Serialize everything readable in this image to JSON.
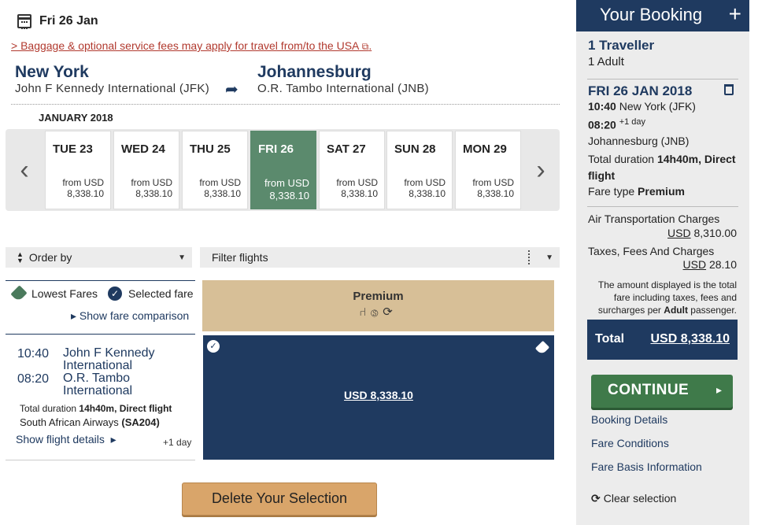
{
  "header": {
    "date": "Fri 26 Jan",
    "baggage_link": "> Baggage & optional service fees may apply for travel from/to the USA"
  },
  "route": {
    "origin_city": "New York",
    "origin_airport": "John F Kennedy International (JFK)",
    "dest_city": "Johannesburg",
    "dest_airport": "O.R. Tambo International (JNB)"
  },
  "calendar": {
    "month": "JANUARY 2018",
    "days": [
      {
        "label": "TUE 23",
        "from": "from USD",
        "price": "8,338.10"
      },
      {
        "label": "WED 24",
        "from": "from USD",
        "price": "8,338.10"
      },
      {
        "label": "THU 25",
        "from": "from USD",
        "price": "8,338.10"
      },
      {
        "label": "FRI 26",
        "from": "from USD",
        "price": "8,338.10"
      },
      {
        "label": "SAT 27",
        "from": "from USD",
        "price": "8,338.10"
      },
      {
        "label": "SUN 28",
        "from": "from USD",
        "price": "8,338.10"
      },
      {
        "label": "MON 29",
        "from": "from USD",
        "price": "8,338.10"
      }
    ]
  },
  "controls": {
    "order_by": "Order by",
    "filter": "Filter flights"
  },
  "legend": {
    "lowest": "Lowest Fares",
    "selected": "Selected fare",
    "compare": "Show fare comparison"
  },
  "cabin": {
    "name": "Premium"
  },
  "flight": {
    "dep_time": "10:40",
    "dep_airport": "John F Kennedy International",
    "arr_time": "08:20",
    "arr_airport": "O.R. Tambo International",
    "duration_label": "Total duration",
    "duration_value": "14h40m, Direct flight",
    "airline": "South African Airways",
    "flight_no": "(SA204)",
    "details": "Show flight details",
    "plus_day": "+1 day",
    "fare_price": "USD 8,338.10"
  },
  "delete_button": "Delete Your Selection",
  "booking": {
    "title": "Your Booking",
    "travellers": "1 Traveller",
    "adults": "1 Adult",
    "date": "FRI 26 JAN 2018",
    "dep_time": "10:40",
    "dep_city": "New York (JFK)",
    "arr_time": "08:20",
    "arr_plus": "+1 day",
    "arr_city": "Johannesburg (JNB)",
    "duration_label": "Total duration",
    "duration_value": "14h40m, Direct flight",
    "fare_type_label": "Fare type",
    "fare_type": "Premium",
    "air_label": "Air Transportation Charges",
    "air_currency": "USD",
    "air_value": "8,310.00",
    "tax_label": "Taxes, Fees And Charges",
    "tax_currency": "USD",
    "tax_value": "28.10",
    "note_1": "The amount displayed is the total fare including taxes, fees and surcharges per",
    "note_bold": "Adult",
    "note_2": "passenger.",
    "total_label": "Total",
    "total_value": "USD 8,338.10",
    "continue": "CONTINUE",
    "link_details": "Booking Details",
    "link_conditions": "Fare Conditions",
    "link_basis": "Fare Basis Information",
    "clear": "Clear selection"
  },
  "colors": {
    "navy": "#1f3a60",
    "selected_day": "#5b8a6d",
    "premium": "#d7bf97",
    "continue": "#3f7a4a",
    "delete": "#d9a56a",
    "link_red": "#b1392e"
  }
}
